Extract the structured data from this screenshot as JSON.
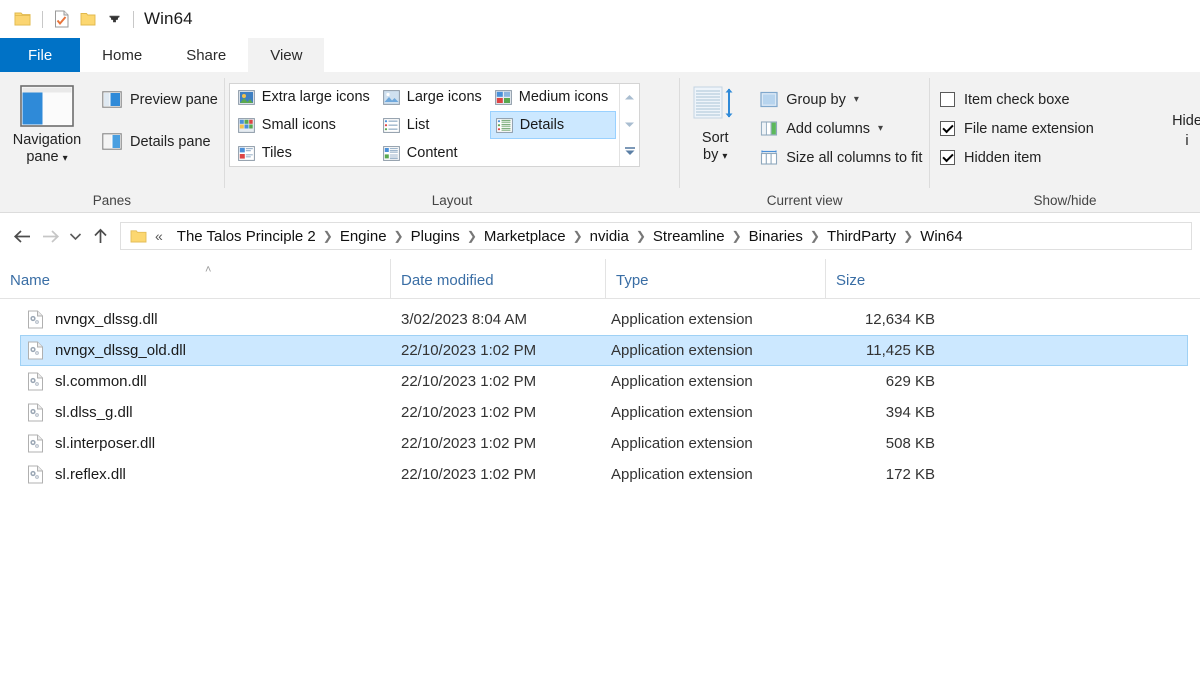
{
  "titlebar": {
    "title": "Win64",
    "qat": [
      "folder-icon",
      "properties-icon",
      "new-folder-icon",
      "customize-chevron-icon"
    ]
  },
  "tabs": [
    {
      "label": "File",
      "state": "file"
    },
    {
      "label": "Home",
      "state": "normal"
    },
    {
      "label": "Share",
      "state": "normal"
    },
    {
      "label": "View",
      "state": "active"
    }
  ],
  "ribbon": {
    "panes": {
      "group_label": "Panes",
      "navigation_pane": "Navigation\npane",
      "navigation_pane_line1": "Navigation",
      "navigation_pane_line2": "pane",
      "preview_pane": "Preview pane",
      "details_pane": "Details pane"
    },
    "layout": {
      "group_label": "Layout",
      "items": [
        {
          "label": "Extra large icons",
          "selected": false
        },
        {
          "label": "Large icons",
          "selected": false
        },
        {
          "label": "Medium icons",
          "selected": false
        },
        {
          "label": "Small icons",
          "selected": false
        },
        {
          "label": "List",
          "selected": false
        },
        {
          "label": "Details",
          "selected": true
        },
        {
          "label": "Tiles",
          "selected": false
        },
        {
          "label": "Content",
          "selected": false
        }
      ]
    },
    "current_view": {
      "group_label": "Current view",
      "sort_by_line1": "Sort",
      "sort_by_line2": "by",
      "group_by": "Group by",
      "add_columns": "Add columns",
      "size_all_columns": "Size all columns to fit"
    },
    "show_hide": {
      "group_label": "Show/hide",
      "item_check_boxes": {
        "label": "Item check boxe",
        "checked": false
      },
      "file_name_extensions": {
        "label": "File name extension",
        "checked": true
      },
      "hidden_items": {
        "label": "Hidden item",
        "checked": true
      },
      "hide_selected_line1": "Hide",
      "hide_selected_line2": "i"
    }
  },
  "addressbar": {
    "back": "back-arrow",
    "forward": "forward-arrow",
    "recent": "recent-locations-chevron",
    "up": "up-arrow",
    "overflow": "«",
    "crumbs": [
      "The Talos Principle 2",
      "Engine",
      "Plugins",
      "Marketplace",
      "nvidia",
      "Streamline",
      "Binaries",
      "ThirdParty",
      "Win64"
    ]
  },
  "columns": {
    "name": "Name",
    "date_modified": "Date modified",
    "type": "Type",
    "size": "Size",
    "sort_indicator": "˄"
  },
  "files": [
    {
      "name": "nvngx_dlssg.dll",
      "date": "3/02/2023 8:04 AM",
      "type": "Application extension",
      "size": "12,634 KB",
      "selected": false
    },
    {
      "name": "nvngx_dlssg_old.dll",
      "date": "22/10/2023 1:02 PM",
      "type": "Application extension",
      "size": "11,425 KB",
      "selected": true
    },
    {
      "name": "sl.common.dll",
      "date": "22/10/2023 1:02 PM",
      "type": "Application extension",
      "size": "629 KB",
      "selected": false
    },
    {
      "name": "sl.dlss_g.dll",
      "date": "22/10/2023 1:02 PM",
      "type": "Application extension",
      "size": "394 KB",
      "selected": false
    },
    {
      "name": "sl.interposer.dll",
      "date": "22/10/2023 1:02 PM",
      "type": "Application extension",
      "size": "508 KB",
      "selected": false
    },
    {
      "name": "sl.reflex.dll",
      "date": "22/10/2023 1:02 PM",
      "type": "Application extension",
      "size": "172 KB",
      "selected": false
    }
  ],
  "colors": {
    "file_tab_blue": "#0072c6",
    "selection_blue": "#cce8ff",
    "selection_border": "#9fd1f5",
    "ribbon_bg": "#f2f2f2",
    "header_text": "#3a6ea5"
  }
}
